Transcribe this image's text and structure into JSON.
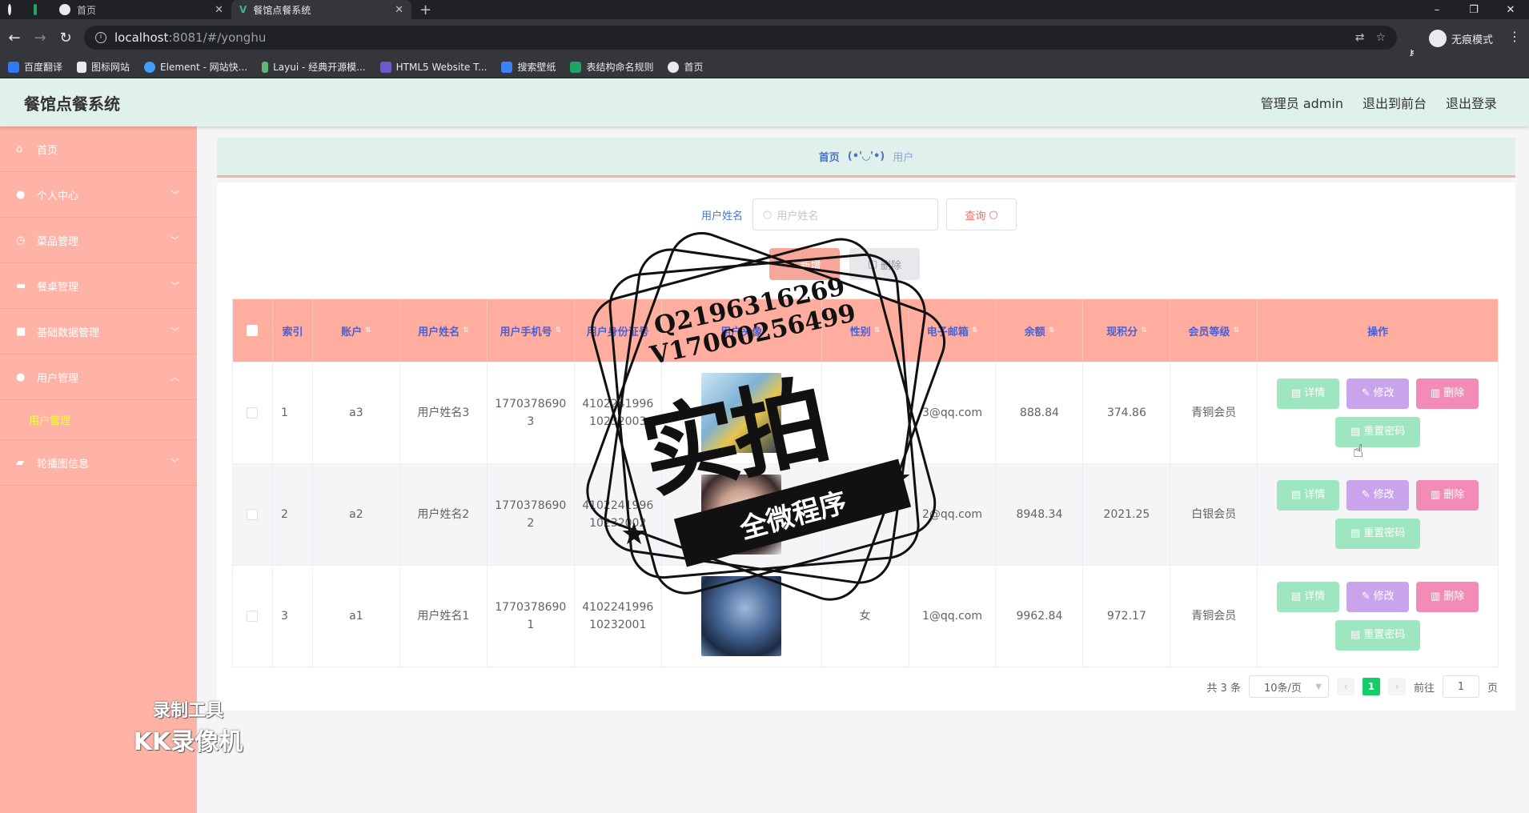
{
  "browser": {
    "tabs": [
      {
        "title": "",
        "active": false
      },
      {
        "title": "",
        "active": false
      },
      {
        "title": "首页",
        "active": false
      },
      {
        "title": "餐馆点餐系统",
        "active": true
      }
    ],
    "new_tab": "+",
    "url_host": "localhost",
    "url_path": ":8081/#/yonghu",
    "profile": "无痕模式",
    "bookmarks": [
      "百度翻译",
      "图标网站",
      "Element - 网站快...",
      "Layui - 经典开源模...",
      "HTML5 Website T...",
      "搜索壁纸",
      "表结构命名规则",
      "首页"
    ]
  },
  "header": {
    "title": "餐馆点餐系统",
    "links": [
      "管理员 admin",
      "退出到前台",
      "退出登录"
    ]
  },
  "sidebar": {
    "items": [
      {
        "label": "首页",
        "icon": "home-icon"
      },
      {
        "label": "个人中心",
        "icon": "user-icon",
        "arrow": "﹀"
      },
      {
        "label": "菜品管理",
        "icon": "clock-icon",
        "arrow": "﹀"
      },
      {
        "label": "餐桌管理",
        "icon": "chat-icon",
        "arrow": "﹀"
      },
      {
        "label": "基础数据管理",
        "icon": "camera-icon",
        "arrow": "﹀"
      },
      {
        "label": "用户管理",
        "icon": "user-icon",
        "arrow": "︿"
      }
    ],
    "sub_item": "用户管理",
    "last_item": {
      "label": "轮播图信息",
      "icon": "briefcase-icon",
      "arrow": "﹀"
    }
  },
  "breadcrumb": {
    "home": "首页",
    "sep": "(•'◡'•)",
    "current": "用户"
  },
  "search": {
    "label": "用户姓名",
    "placeholder": "用户姓名",
    "query_btn": "查询"
  },
  "actions": {
    "add": "新增",
    "delete": "删除"
  },
  "table": {
    "headers": [
      "索引",
      "账户",
      "用户姓名",
      "用户手机号",
      "用户身份证号",
      "用户头像",
      "性别",
      "电子邮箱",
      "余额",
      "现积分",
      "会员等级",
      "操作"
    ],
    "rows": [
      {
        "index": "1",
        "account": "a3",
        "name": "用户姓名3",
        "phone": "17703786903",
        "idcard": "410224199610232003",
        "gender": "",
        "email": "3@qq.com",
        "balance": "888.84",
        "points": "374.86",
        "level": "青铜会员"
      },
      {
        "index": "2",
        "account": "a2",
        "name": "用户姓名2",
        "phone": "17703786902",
        "idcard": "410224199610232002",
        "gender": "",
        "email": "2@qq.com",
        "balance": "8948.34",
        "points": "2021.25",
        "level": "白银会员"
      },
      {
        "index": "3",
        "account": "a1",
        "name": "用户姓名1",
        "phone": "17703786901",
        "idcard": "410224199610232001",
        "gender": "女",
        "email": "1@qq.com",
        "balance": "9962.84",
        "points": "972.17",
        "level": "青铜会员"
      }
    ],
    "ops": {
      "detail": "详情",
      "edit": "修改",
      "remove": "删除",
      "reset": "重置密码"
    }
  },
  "pager": {
    "total": "共 3 条",
    "page_size": "10条/页",
    "current": "1",
    "goto_label": "前往",
    "goto_value": "1",
    "page_unit": "页"
  },
  "watermark": {
    "line1": "Q2196316269",
    "line2": "V17060256499",
    "big": "实拍",
    "banner": "全微程序",
    "rec1": "录制工具",
    "rec2": "KK录像机"
  },
  "colors": {
    "header_bg": "#e0f1ec",
    "sidebar_bg": "#ffb3a7",
    "table_head_bg": "#ffad9f",
    "accent_blue": "#4b5fd4",
    "active_sub": "#f7ff3d"
  }
}
